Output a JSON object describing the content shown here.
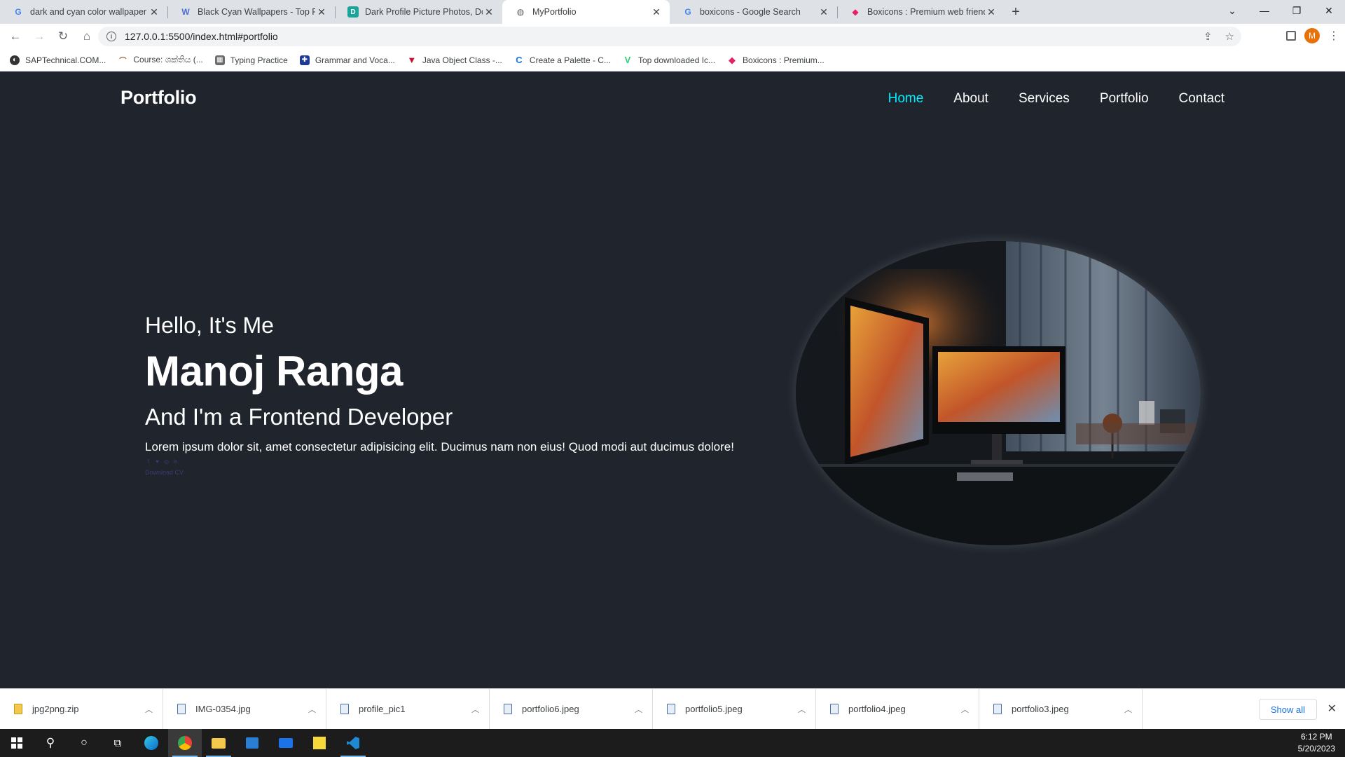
{
  "browser": {
    "tabs": [
      {
        "title": "dark and cyan color wallpaper - G",
        "icon": "google-icon",
        "active": false
      },
      {
        "title": "Black Cyan Wallpapers - Top Free",
        "icon": "wallpaper-site-icon",
        "active": false
      },
      {
        "title": "Dark Profile Picture Photos, Down",
        "icon": "photo-site-icon",
        "active": false
      },
      {
        "title": "MyPortfolio",
        "icon": "globe-icon",
        "active": true
      },
      {
        "title": "boxicons - Google Search",
        "icon": "google-icon",
        "active": false
      },
      {
        "title": "Boxicons : Premium web friendly",
        "icon": "boxicons-icon",
        "active": false
      }
    ],
    "new_tab": "+",
    "url": "127.0.0.1:5500/index.html#portfolio",
    "profile_initial": "M",
    "bookmarks": [
      {
        "label": "SAPTechnical.COM...",
        "color": "#333333"
      },
      {
        "label": "Course: ශක්තිය (...",
        "color": "#8b5a2b"
      },
      {
        "label": "Typing Practice",
        "color": "#6b6b6b"
      },
      {
        "label": "Grammar and Voca...",
        "color": "#b22234"
      },
      {
        "label": "Java Object Class -...",
        "color": "#c8102e"
      },
      {
        "label": "Create a Palette - C...",
        "color": "#1a73e8"
      },
      {
        "label": "Top downloaded Ic...",
        "color": "#2ecc71"
      },
      {
        "label": "Boxicons : Premium...",
        "color": "#e91e63"
      }
    ]
  },
  "site": {
    "logo": "Portfolio",
    "nav": [
      {
        "label": "Home",
        "active": true
      },
      {
        "label": "About",
        "active": false
      },
      {
        "label": "Services",
        "active": false
      },
      {
        "label": "Portfolio",
        "active": false
      },
      {
        "label": "Contact",
        "active": false
      }
    ],
    "hero": {
      "greeting": "Hello, It's Me",
      "name": "Manoj Ranga",
      "role": "And I'm a Frontend Developer",
      "description": "Lorem ipsum dolor sit, amet consectetur adipisicing elit. Ducimus nam non eius! Quod modi aut ducimus dolore!",
      "social_icons": [
        "facebook-icon",
        "twitter-icon",
        "instagram-icon",
        "linkedin-icon"
      ],
      "cv_button": "Download CV"
    },
    "accent_color": "#00eeff",
    "background_color": "#1f242d"
  },
  "downloads": {
    "items": [
      {
        "name": "jpg2png.zip",
        "type": "zip"
      },
      {
        "name": "IMG-0354.jpg",
        "type": "image"
      },
      {
        "name": "profile_pic1",
        "type": "image"
      },
      {
        "name": "portfolio6.jpeg",
        "type": "image"
      },
      {
        "name": "portfolio5.jpeg",
        "type": "image"
      },
      {
        "name": "portfolio4.jpeg",
        "type": "image"
      },
      {
        "name": "portfolio3.jpeg",
        "type": "image"
      }
    ],
    "show_all": "Show all"
  },
  "taskbar": {
    "time": "6:12 PM",
    "date": "5/20/2023"
  }
}
